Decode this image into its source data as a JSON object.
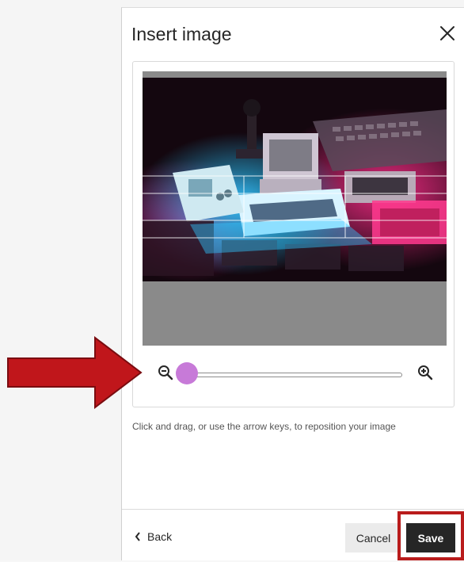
{
  "dialog": {
    "title": "Insert image",
    "close_icon": "close-icon"
  },
  "editor": {
    "zoom_out_icon": "zoom-out-icon",
    "zoom_in_icon": "zoom-in-icon",
    "zoom_level": 0,
    "hint": "Click and drag, or use the arrow keys, to reposition your image"
  },
  "footer": {
    "back_label": "Back",
    "cancel_label": "Cancel",
    "save_label": "Save"
  },
  "annotations": {
    "arrow_color": "#c0161b",
    "highlight_color": "#b91c1c"
  },
  "colors": {
    "slider_thumb": "#c77ad8",
    "save_bg": "#262626",
    "cancel_bg": "#ebebeb"
  }
}
